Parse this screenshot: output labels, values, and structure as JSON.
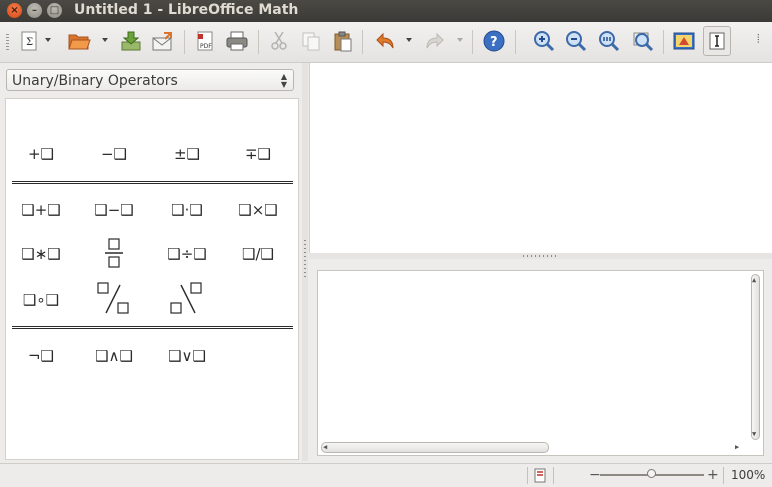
{
  "window": {
    "title": "Untitled 1 - LibreOffice Math",
    "close_glyph": "×",
    "minimize_glyph": "–",
    "maximize_glyph": "□"
  },
  "toolbar": {
    "icons": [
      "formula-icon",
      "open-icon",
      "save-icon",
      "mail-icon",
      "export-pdf-icon",
      "print-icon",
      "cut-icon",
      "copy-icon",
      "paste-icon",
      "undo-icon",
      "redo-icon",
      "help-icon",
      "zoom-in-icon",
      "zoom-out-icon",
      "zoom-100-icon",
      "show-all-icon",
      "update-icon",
      "formula-cursor-icon"
    ],
    "more_glyph": "⦙"
  },
  "elements_panel": {
    "category": "Unary/Binary Operators",
    "unary_ops": [
      "+❑",
      "−❑",
      "±❑",
      "∓❑"
    ],
    "binary_ops_row1": [
      "❑+❑",
      "❑−❑",
      "❑·❑",
      "❑×❑"
    ],
    "binary_ops_row2": [
      "❑∗❑",
      "",
      "❑÷❑",
      "❑/❑"
    ],
    "binary_ops_row3": [
      "❑∘❑"
    ],
    "logic_ops": [
      "¬❑",
      "❑∧❑",
      "❑∨❑"
    ]
  },
  "statusbar": {
    "zoom_percent": "100%",
    "zoom_minus": "−",
    "zoom_plus": "+",
    "zoom_level": 0.5
  }
}
